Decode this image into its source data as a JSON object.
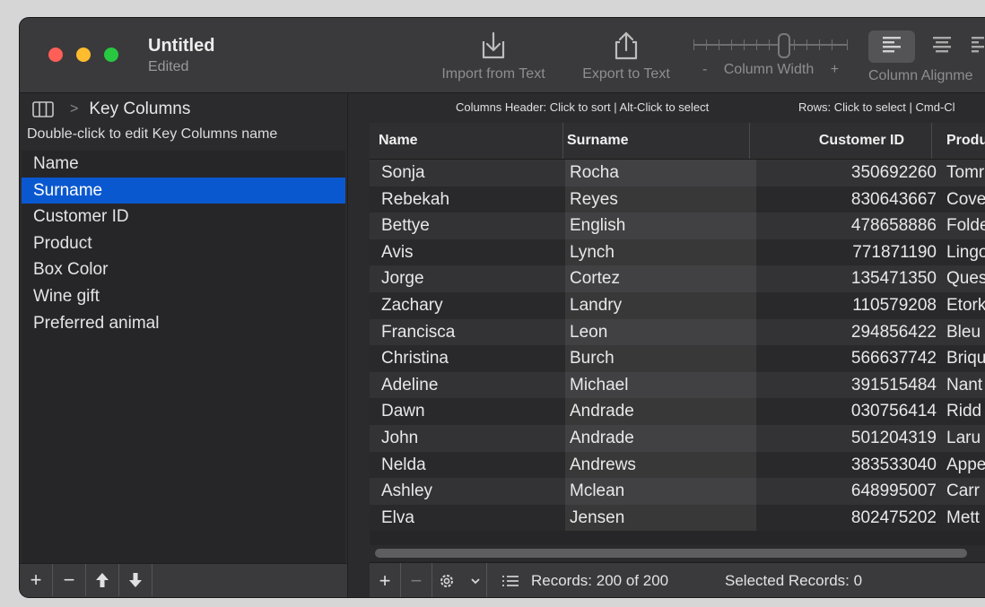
{
  "window": {
    "title": "Untitled",
    "subtitle": "Edited"
  },
  "toolbar": {
    "import_label": "Import from Text",
    "export_label": "Export to Text",
    "colwidth_minus": "-",
    "colwidth_label": "Column Width",
    "colwidth_plus": "+",
    "align_label": "Column Alignme"
  },
  "sidebar": {
    "breadcrumb": "Key Columns",
    "hint": "Double-click to edit Key Columns name",
    "items": [
      {
        "label": "Name"
      },
      {
        "label": "Surname"
      },
      {
        "label": "Customer ID"
      },
      {
        "label": "Product"
      },
      {
        "label": "Box Color"
      },
      {
        "label": "Wine gift"
      },
      {
        "label": "Preferred animal"
      }
    ],
    "selected_index": 1,
    "footer": {
      "add": "+",
      "remove": "−"
    }
  },
  "info": {
    "columns_header": "Columns Header: Click to sort | Alt-Click to select",
    "rows": "Rows: Click to select | Cmd-Cl"
  },
  "table": {
    "columns": [
      "Name",
      "Surname",
      "Customer ID",
      "Produ"
    ],
    "rows": [
      [
        "Sonja",
        "Rocha",
        "350692260",
        "Tomr"
      ],
      [
        "Rebekah",
        "Reyes",
        "830643667",
        "Cove"
      ],
      [
        "Bettye",
        "English",
        "478658886",
        "Folde"
      ],
      [
        "Avis",
        "Lynch",
        "771871190",
        "Lingo"
      ],
      [
        "Jorge",
        "Cortez",
        "135471350",
        "Ques"
      ],
      [
        "Zachary",
        "Landry",
        "110579208",
        "Etork"
      ],
      [
        "Francisca",
        "Leon",
        "294856422",
        "Bleu"
      ],
      [
        "Christina",
        "Burch",
        "566637742",
        "Briqu"
      ],
      [
        "Adeline",
        "Michael",
        "391515484",
        "Nant"
      ],
      [
        "Dawn",
        "Andrade",
        "030756414",
        "Ridd"
      ],
      [
        "John",
        "Andrade",
        "501204319",
        "Laru"
      ],
      [
        "Nelda",
        "Andrews",
        "383533040",
        "Appe"
      ],
      [
        "Ashley",
        "Mclean",
        "648995007",
        "Carr"
      ],
      [
        "Elva",
        "Jensen",
        "802475202",
        "Mett"
      ]
    ]
  },
  "footer": {
    "add": "+",
    "remove": "−",
    "records": "Records: 200 of 200",
    "selected": "Selected Records: 0"
  },
  "colors": {
    "selection": "#0a58d0",
    "window_bg": "#2b2b2d"
  }
}
